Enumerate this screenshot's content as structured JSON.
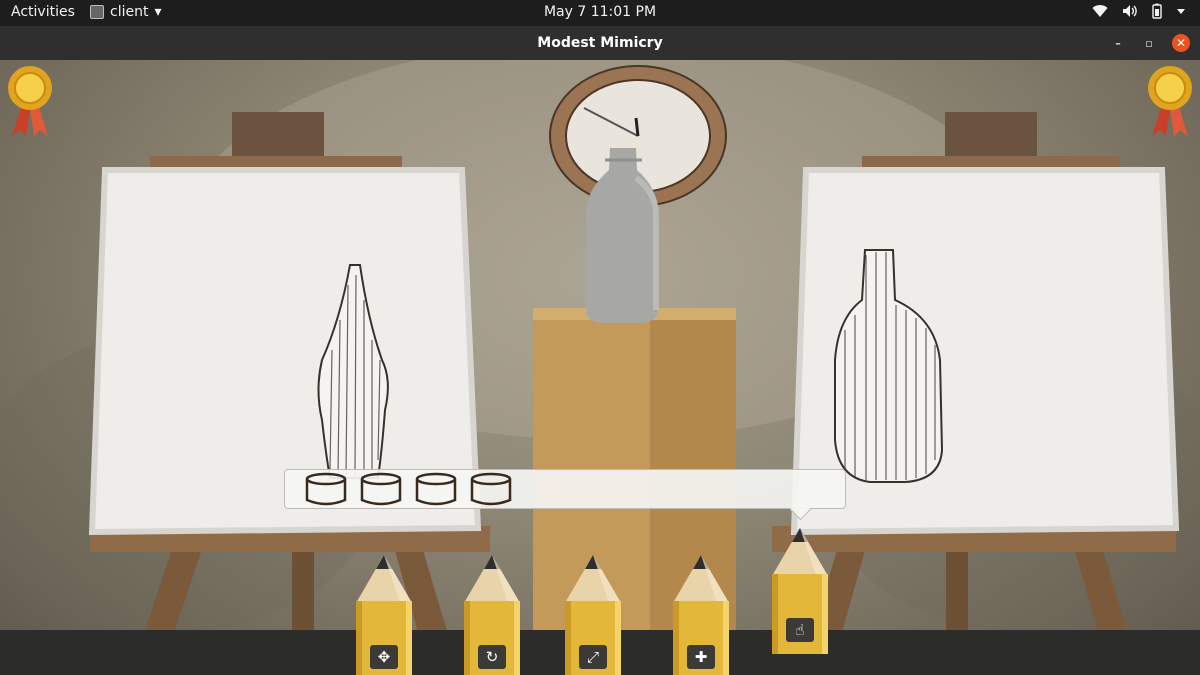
{
  "topbar": {
    "activities": "Activities",
    "app_name": "client",
    "app_menu_arrow": "▾",
    "clock": "May 7  11:01 PM",
    "tray_icons": [
      "wifi-icon",
      "volume-icon",
      "battery-icon",
      "system-menu-arrow-icon"
    ]
  },
  "window": {
    "title": "Modest Mimicry",
    "minimize_glyph": "–",
    "maximize_glyph": "▫",
    "close_glyph": "✕",
    "close_color": "#e95420"
  },
  "game": {
    "medals": [
      "gold-medal-icon",
      "gold-medal-icon"
    ],
    "attempts_remaining": 4,
    "attempt_icon": "cylinder-icon",
    "selected_tool_index": 4,
    "tools": [
      {
        "name": "move-tool",
        "glyph": "✥"
      },
      {
        "name": "rotate-tool",
        "glyph": "↻"
      },
      {
        "name": "scale-tool",
        "glyph": "⤢"
      },
      {
        "name": "add-tool",
        "glyph": "✚"
      },
      {
        "name": "pointer-tool",
        "glyph": "☝"
      }
    ]
  }
}
